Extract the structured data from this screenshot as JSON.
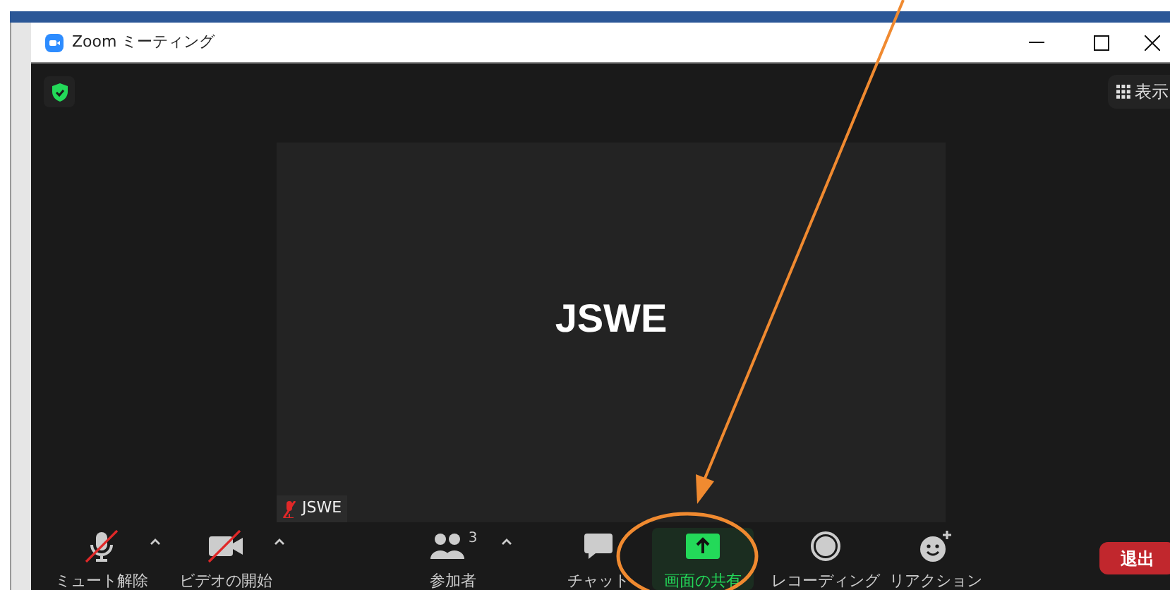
{
  "window": {
    "title": "Zoom ミーティング"
  },
  "view_button": {
    "label": "表示"
  },
  "video_tile": {
    "name": "JSWE",
    "display_name": "JSWE",
    "muted": true
  },
  "toolbar": [
    {
      "kind": "mic",
      "label": "ミュート解除",
      "off": true,
      "has_menu": true,
      "selected": false
    },
    {
      "kind": "video",
      "label": "ビデオの開始",
      "off": true,
      "has_menu": true,
      "selected": false
    },
    {
      "kind": "participants",
      "label": "参加者",
      "count": "3",
      "has_menu": true,
      "selected": false
    },
    {
      "kind": "chat",
      "label": "チャット",
      "has_menu": false,
      "selected": false
    },
    {
      "kind": "share",
      "label": "画面の共有",
      "has_menu": false,
      "selected": true
    },
    {
      "kind": "record",
      "label": "レコーディング",
      "has_menu": false,
      "selected": false
    },
    {
      "kind": "reaction",
      "label": "リアクション",
      "has_menu": false,
      "selected": false
    }
  ],
  "leave_button": {
    "label": "退出"
  }
}
